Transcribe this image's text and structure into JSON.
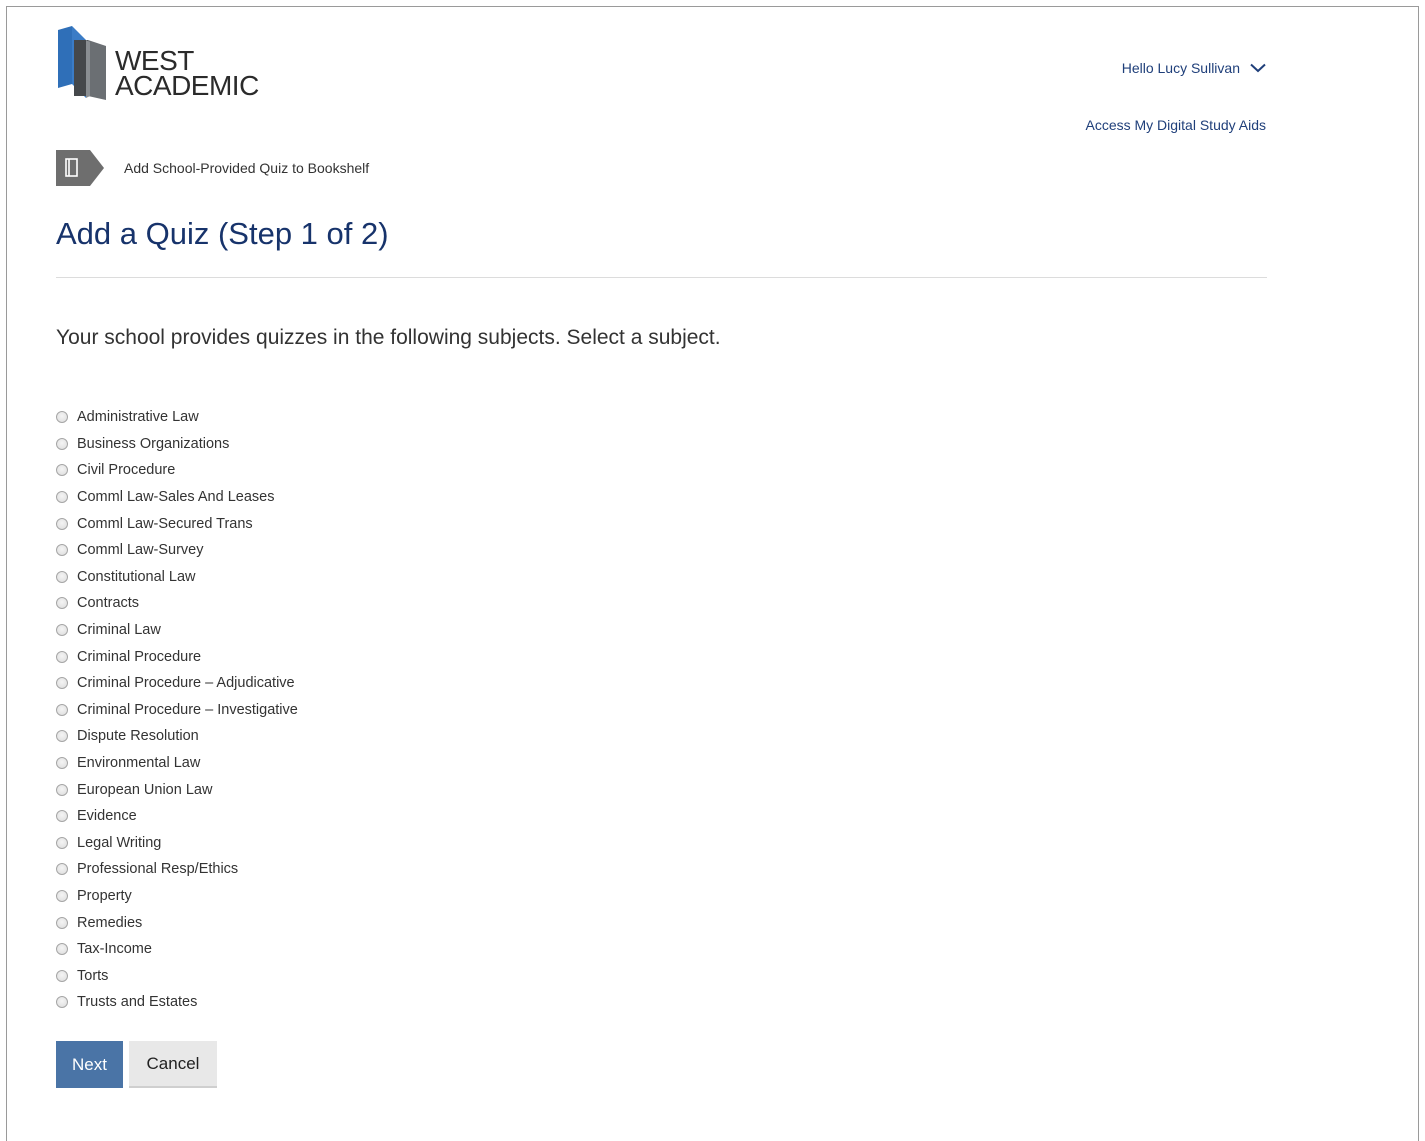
{
  "brand": {
    "line1": "WEST",
    "line2": "ACADEMIC"
  },
  "header": {
    "greeting": "Hello Lucy Sullivan",
    "study_aids_link": "Access My Digital Study Aids"
  },
  "breadcrumb": {
    "label": "Add School-Provided Quiz to Bookshelf"
  },
  "page": {
    "title": "Add a Quiz (Step 1 of 2)",
    "instruction": "Your school provides quizzes in the following subjects. Select a subject."
  },
  "subjects": [
    "Administrative Law",
    "Business Organizations",
    "Civil Procedure",
    "Comml Law-Sales And Leases",
    "Comml Law-Secured Trans",
    "Comml Law-Survey",
    "Constitutional Law",
    "Contracts",
    "Criminal Law",
    "Criminal Procedure",
    "Criminal Procedure – Adjudicative",
    "Criminal Procedure – Investigative",
    "Dispute Resolution",
    "Environmental Law",
    "European Union Law",
    "Evidence",
    "Legal Writing",
    "Professional Resp/Ethics",
    "Property",
    "Remedies",
    "Tax-Income",
    "Torts",
    "Trusts and Estates"
  ],
  "buttons": {
    "next": "Next",
    "cancel": "Cancel"
  },
  "colors": {
    "title": "#17336b",
    "link": "#1f3f7a",
    "primary_button": "#4a74a6",
    "logo_blue": "#2f6fb8",
    "logo_gray": "#6b6f73"
  }
}
